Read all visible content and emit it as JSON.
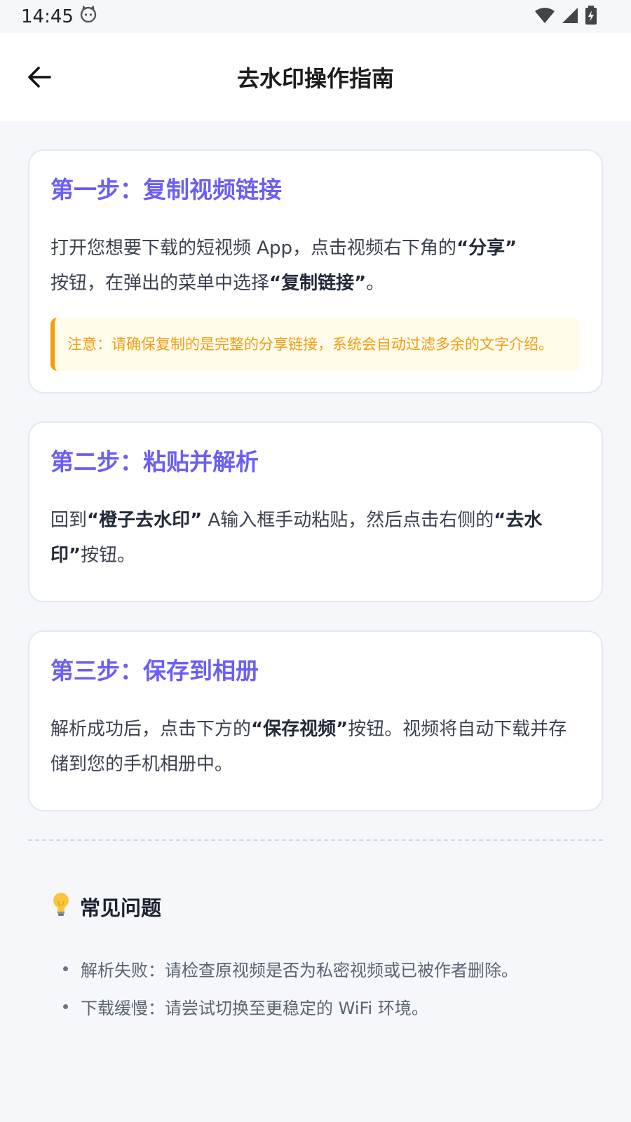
{
  "status": {
    "time": "14:45"
  },
  "header": {
    "title": "去水印操作指南"
  },
  "steps": [
    {
      "title": "第一步：复制视频链接",
      "p1": "打开您想要下载的短视频 App，点击视频右下角的",
      "b1": "“分享”",
      "p2": "按钮，在弹出的菜单中选择",
      "b2": "“复制链接”",
      "p3": "。",
      "note": "注意：请确保复制的是完整的分享链接，系统会自动过滤多余的文字介绍。"
    },
    {
      "title": "第二步：粘贴并解析",
      "p1": "回到",
      "b1": "“橙子去水印”",
      "p2": " A输入框手动粘贴，然后点击右侧的",
      "b2": "“去水印”",
      "p3": "按钮。"
    },
    {
      "title": "第三步：保存到相册",
      "p1": "解析成功后，点击下方的",
      "b1": "“保存视频”",
      "p2": "按钮。视频将自动下载并存储到您的手机相册中。"
    }
  ],
  "faq": {
    "title": "常见问题",
    "items": [
      "解析失败：请检查原视频是否为私密视频或已被作者删除。",
      "下载缓慢：请尝试切换至更稳定的 WiFi 环境。"
    ]
  }
}
